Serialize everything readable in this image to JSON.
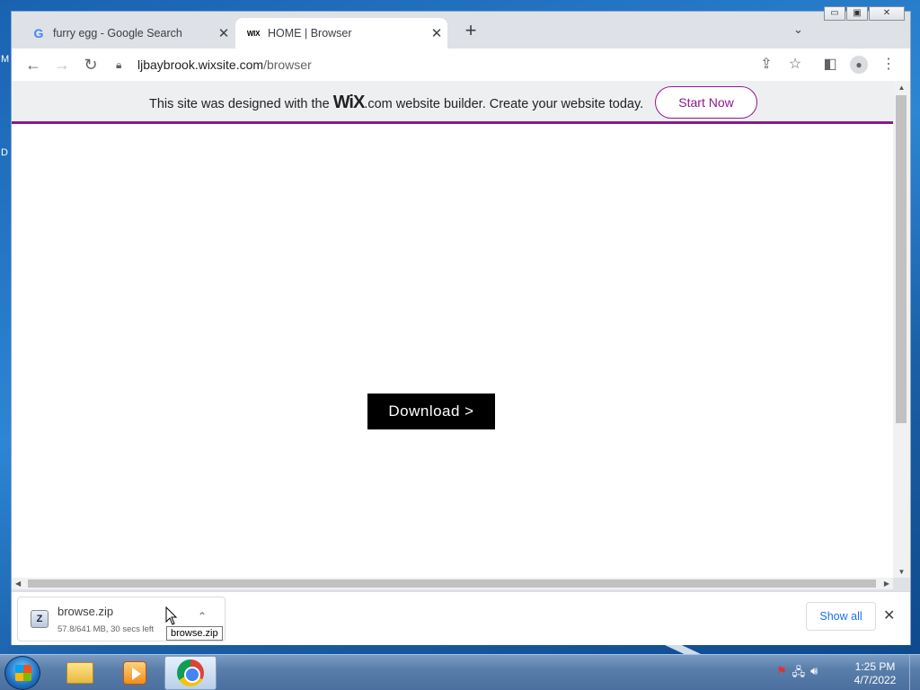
{
  "desktop": {
    "edge_text_1": "M",
    "edge_text_2": "D"
  },
  "window_controls": {
    "minimize": "▭",
    "maximize": "▣",
    "close": "✕"
  },
  "tabs": [
    {
      "title": "furry egg - Google Search",
      "favicon": "google-icon"
    },
    {
      "title": "HOME | Browser",
      "favicon": "wix-icon",
      "favicon_text": "WIX"
    }
  ],
  "toolbar": {
    "url_host": "ljbaybrook.wixsite.com",
    "url_path": "/browser"
  },
  "wix_banner": {
    "text_before": "This site was designed with the ",
    "logo": "WiX",
    "text_after": ".com website builder. Create your website today.",
    "button": "Start Now",
    "accent_color": "#8b1a8b"
  },
  "page": {
    "download_button": "Download >"
  },
  "download_shelf": {
    "file_name": "browse.zip",
    "status": "57.8/641 MB, 30 secs left",
    "show_all": "Show all",
    "tooltip": "browse.zip"
  },
  "taskbar": {
    "time": "1:25 PM",
    "date": "4/7/2022",
    "apps": [
      "windows-explorer",
      "media-player",
      "google-chrome"
    ]
  }
}
